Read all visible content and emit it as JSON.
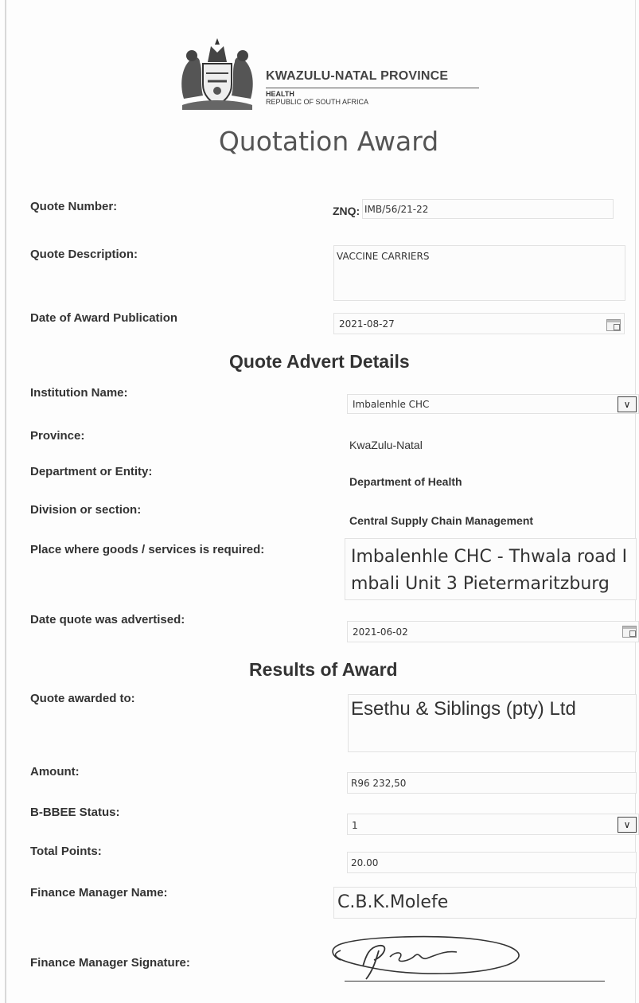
{
  "header": {
    "province": "KWAZULU-NATAL PROVINCE",
    "dept": "HEALTH",
    "republic": "REPUBLIC OF SOUTH AFRICA"
  },
  "title": "Quotation Award",
  "quote": {
    "number_label": "Quote Number:",
    "number_prefix": "ZNQ:",
    "number_value": "IMB/56/21-22",
    "desc_label": "Quote Description:",
    "desc_value": "VACCINE CARRIERS",
    "award_date_label": "Date of Award Publication",
    "award_date_value": "2021-08-27"
  },
  "advert": {
    "heading": "Quote Advert Details",
    "institution_label": "Institution Name:",
    "institution_value": "Imbalenhle CHC",
    "province_label": "Province:",
    "province_value": "KwaZulu-Natal",
    "department_label": "Department or Entity:",
    "department_value": "Department of Health",
    "division_label": "Division or section:",
    "division_value": "Central Supply Chain Management",
    "place_label": "Place where goods /  services is required:",
    "place_line1": "Imbalenhle CHC - Thwala road I",
    "place_line2": "mbali Unit 3 Pietermaritzburg",
    "advertised_label": "Date quote was advertised:",
    "advertised_value": "2021-06-02"
  },
  "results": {
    "heading": "Results of Award",
    "awarded_label": "Quote awarded to:",
    "awarded_value": "Esethu & Siblings (pty) Ltd",
    "amount_label": "Amount:",
    "amount_value": "R96 232,50",
    "bbbee_label": "B-BBEE Status:",
    "bbbee_value": "1",
    "points_label": "Total Points:",
    "points_value": "20.00",
    "fm_name_label": "Finance Manager Name:",
    "fm_name_value": "C.B.K.Molefe",
    "fm_sig_label": "Finance Manager Signature:"
  },
  "icons": {
    "calendar": "calendar-icon",
    "dropdown": "chevron-down-icon",
    "crest": "coat-of-arms-icon",
    "signature": "signature-scribble"
  }
}
